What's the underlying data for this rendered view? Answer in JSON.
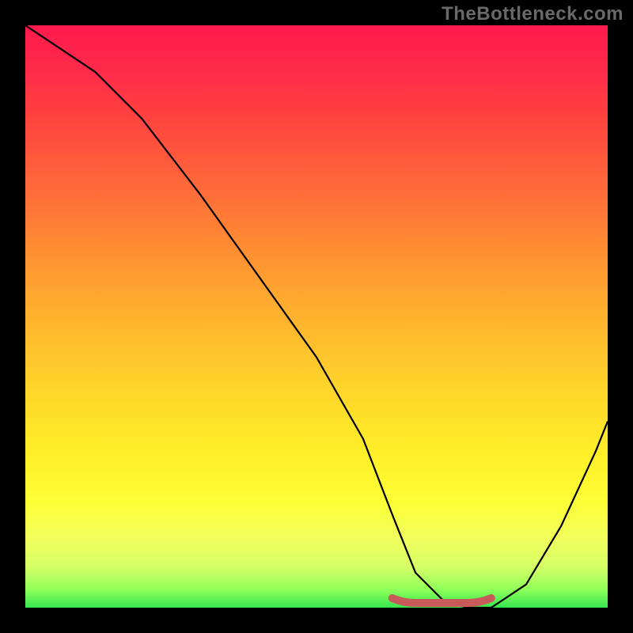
{
  "watermark": "TheBottleneck.com",
  "colors": {
    "bg": "#000000",
    "gradient_top": "#ff1a4d",
    "gradient_bottom": "#35e64f",
    "curve": "#000000",
    "flat_segment": "#c85a5a",
    "watermark": "#696969"
  },
  "chart_data": {
    "type": "line",
    "title": "",
    "xlabel": "",
    "ylabel": "",
    "xlim": [
      0,
      100
    ],
    "ylim": [
      0,
      100
    ],
    "grid": false,
    "x": [
      0,
      6,
      12,
      20,
      30,
      40,
      50,
      58,
      63,
      67,
      72,
      76,
      80,
      86,
      92,
      98,
      100
    ],
    "values": [
      100,
      96,
      92,
      84,
      71,
      57,
      43,
      29,
      16,
      6,
      1,
      0,
      0,
      4,
      14,
      27,
      32
    ],
    "flat_region_x": [
      63,
      80
    ],
    "note": "Values read from vertical position on gradient; 100 = top (red / bottleneck), 0 = bottom (green / optimal). Minimum plateau near x≈70–80."
  }
}
